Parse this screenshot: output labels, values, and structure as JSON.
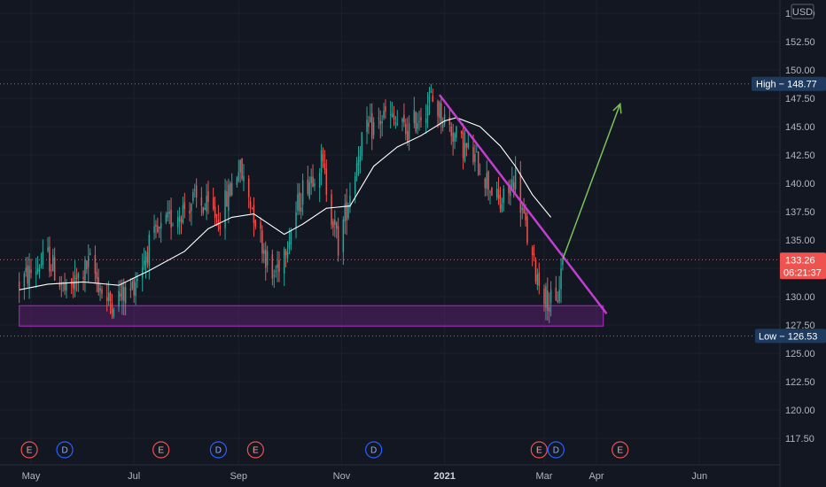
{
  "currency": "USD",
  "colors": {
    "background": "#131722",
    "up": "#26a69a",
    "down": "#ef5350",
    "ma": "#ffffff",
    "zone": "#9c27b0",
    "trendline": "#c13ed0",
    "projection": "#7cc25a",
    "price_tag": "#ef5350",
    "high_low_tag": "#1e3a5f",
    "earnings": "#ef5350",
    "dividend": "#2962ff"
  },
  "chart_data": {
    "type": "candlestick",
    "y_axis": {
      "min": 115.5,
      "max": 156.0,
      "ticks": [
        "117.50",
        "120.00",
        "122.50",
        "125.00",
        "127.50",
        "130.00",
        "132.50",
        "135.00",
        "137.50",
        "140.00",
        "142.50",
        "145.00",
        "147.50",
        "150.00",
        "152.50",
        "155.00"
      ]
    },
    "x_axis": {
      "labels": [
        "May",
        "Jul",
        "Sep",
        "Nov",
        "2021",
        "Mar",
        "Apr",
        "Jun"
      ],
      "bold_label": "2021"
    },
    "high": {
      "label": "High",
      "value": "148.77",
      "num": 148.77
    },
    "low": {
      "label": "Low",
      "value": "126.53",
      "num": 126.53
    },
    "last_price": {
      "value": "133.26",
      "num": 133.26,
      "countdown": "06:21:37"
    },
    "anchors": [
      {
        "date": "2020-04-24",
        "close": 131.2
      },
      {
        "date": "2020-05-11",
        "close": 133.5
      },
      {
        "date": "2020-05-22",
        "close": 130.2
      },
      {
        "date": "2020-06-05",
        "close": 133.0
      },
      {
        "date": "2020-06-15",
        "close": 129.5
      },
      {
        "date": "2020-06-29",
        "close": 130.5
      },
      {
        "date": "2020-07-10",
        "close": 134.5
      },
      {
        "date": "2020-07-24",
        "close": 137.0
      },
      {
        "date": "2020-08-05",
        "close": 138.5
      },
      {
        "date": "2020-08-21",
        "close": 137.0
      },
      {
        "date": "2020-09-01",
        "close": 141.5
      },
      {
        "date": "2020-09-10",
        "close": 137.5
      },
      {
        "date": "2020-09-21",
        "close": 131.5
      },
      {
        "date": "2020-10-01",
        "close": 135.5
      },
      {
        "date": "2020-10-09",
        "close": 139.5
      },
      {
        "date": "2020-10-20",
        "close": 142.0
      },
      {
        "date": "2020-10-30",
        "close": 134.5
      },
      {
        "date": "2020-11-13",
        "close": 144.0
      },
      {
        "date": "2020-11-27",
        "close": 146.0
      },
      {
        "date": "2020-12-10",
        "close": 144.5
      },
      {
        "date": "2020-12-24",
        "close": 147.5
      },
      {
        "date": "2021-01-08",
        "close": 144.0
      },
      {
        "date": "2021-01-22",
        "close": 141.5
      },
      {
        "date": "2021-02-03",
        "close": 138.0
      },
      {
        "date": "2021-02-12",
        "close": 140.5
      },
      {
        "date": "2021-02-22",
        "close": 133.0
      },
      {
        "date": "2021-03-02",
        "close": 130.0
      },
      {
        "date": "2021-03-08",
        "close": 129.0
      },
      {
        "date": "2021-03-12",
        "close": 133.26
      }
    ],
    "moving_average": [
      {
        "date": "2020-04-24",
        "value": 130.6
      },
      {
        "date": "2020-05-11",
        "value": 131.1
      },
      {
        "date": "2020-06-01",
        "value": 131.3
      },
      {
        "date": "2020-06-22",
        "value": 131.0
      },
      {
        "date": "2020-07-10",
        "value": 132.3
      },
      {
        "date": "2020-07-31",
        "value": 134.0
      },
      {
        "date": "2020-08-14",
        "value": 136.0
      },
      {
        "date": "2020-08-28",
        "value": 137.0
      },
      {
        "date": "2020-09-10",
        "value": 137.3
      },
      {
        "date": "2020-09-28",
        "value": 135.5
      },
      {
        "date": "2020-10-09",
        "value": 136.4
      },
      {
        "date": "2020-10-23",
        "value": 137.8
      },
      {
        "date": "2020-11-06",
        "value": 138.0
      },
      {
        "date": "2020-11-20",
        "value": 141.5
      },
      {
        "date": "2020-12-04",
        "value": 143.2
      },
      {
        "date": "2020-12-18",
        "value": 144.2
      },
      {
        "date": "2021-01-01",
        "value": 145.5
      },
      {
        "date": "2021-01-08",
        "value": 145.8
      },
      {
        "date": "2021-01-22",
        "value": 145.0
      },
      {
        "date": "2021-02-03",
        "value": 143.3
      },
      {
        "date": "2021-02-12",
        "value": 141.5
      },
      {
        "date": "2021-02-22",
        "value": 139.0
      },
      {
        "date": "2021-03-05",
        "value": 137.0
      }
    ],
    "support_zone": {
      "from": "2020-04-24",
      "to": "2021-04-05",
      "top": 129.2,
      "bottom": 127.4
    },
    "trendline": {
      "from": {
        "date": "2020-12-29",
        "value": 147.8
      },
      "to": {
        "date": "2021-04-07",
        "value": 128.5
      }
    },
    "projection_arrow": {
      "from": {
        "date": "2021-03-12",
        "value": 133.3
      },
      "to": {
        "date": "2021-04-15",
        "value": 147.0
      }
    },
    "events": [
      {
        "type": "E",
        "date": "2020-04-30"
      },
      {
        "type": "D",
        "date": "2020-05-21"
      },
      {
        "type": "E",
        "date": "2020-07-17"
      },
      {
        "type": "D",
        "date": "2020-08-20"
      },
      {
        "type": "E",
        "date": "2020-09-11"
      },
      {
        "type": "D",
        "date": "2020-11-20"
      },
      {
        "type": "E",
        "date": "2021-02-26"
      },
      {
        "type": "D",
        "date": "2021-03-08"
      },
      {
        "type": "E",
        "date": "2021-04-15"
      }
    ]
  }
}
